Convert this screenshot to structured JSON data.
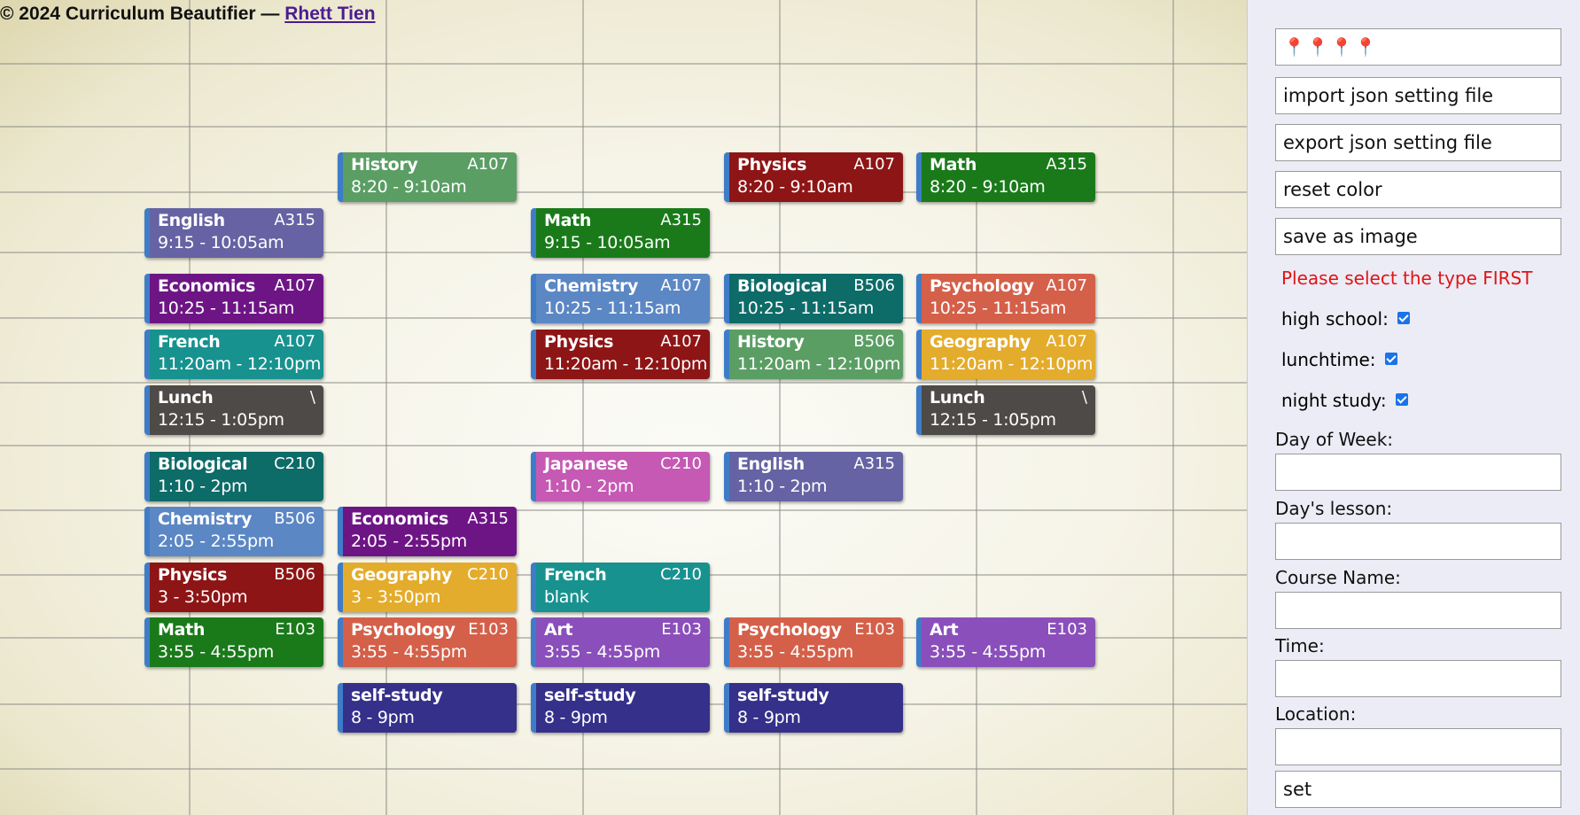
{
  "credit": {
    "prefix": "© 2024 Curriculum Beautifier — ",
    "author": "Rhett Tien"
  },
  "colors": {
    "History": "#5a9e64",
    "Physics": "#8e1515",
    "Math": "#1a7a1a",
    "English": "#6563a3",
    "Economics": "#6e1585",
    "Chemistry": "#5b87c4",
    "Biological": "#0d6b68",
    "Psychology": "#d4604a",
    "French": "#17928f",
    "Geography": "#e4ac2c",
    "Lunch": "#4e4a47",
    "Japanese": "#c559b3",
    "Art": "#8a4fbb",
    "self-study": "#35308a"
  },
  "lessons": [
    {
      "name": "History",
      "room": "A107",
      "time": "8:20 - 9:10am",
      "col": 1,
      "row": 0
    },
    {
      "name": "Physics",
      "room": "A107",
      "time": "8:20 - 9:10am",
      "col": 3,
      "row": 0
    },
    {
      "name": "Math",
      "room": "A315",
      "time": "8:20 - 9:10am",
      "col": 4,
      "row": 0
    },
    {
      "name": "English",
      "room": "A315",
      "time": "9:15 - 10:05am",
      "col": 0,
      "row": 1
    },
    {
      "name": "Math",
      "room": "A315",
      "time": "9:15 - 10:05am",
      "col": 2,
      "row": 1
    },
    {
      "name": "Economics",
      "room": "A107",
      "time": "10:25 - 11:15am",
      "col": 0,
      "row": 2
    },
    {
      "name": "Chemistry",
      "room": "A107",
      "time": "10:25 - 11:15am",
      "col": 2,
      "row": 2
    },
    {
      "name": "Biological",
      "room": "B506",
      "time": "10:25 - 11:15am",
      "col": 3,
      "row": 2
    },
    {
      "name": "Psychology",
      "room": "A107",
      "time": "10:25 - 11:15am",
      "col": 4,
      "row": 2
    },
    {
      "name": "French",
      "room": "A107",
      "time": "11:20am - 12:10pm",
      "col": 0,
      "row": 3
    },
    {
      "name": "Physics",
      "room": "A107",
      "time": "11:20am - 12:10pm",
      "col": 2,
      "row": 3
    },
    {
      "name": "History",
      "room": "B506",
      "time": "11:20am - 12:10pm",
      "col": 3,
      "row": 3
    },
    {
      "name": "Geography",
      "room": "A107",
      "time": "11:20am - 12:10pm",
      "col": 4,
      "row": 3
    },
    {
      "name": "Lunch",
      "room": "\\",
      "time": "12:15 - 1:05pm",
      "col": 0,
      "row": 4
    },
    {
      "name": "Lunch",
      "room": "\\",
      "time": "12:15 - 1:05pm",
      "col": 4,
      "row": 4
    },
    {
      "name": "Biological",
      "room": "C210",
      "time": "1:10 - 2pm",
      "col": 0,
      "row": 5
    },
    {
      "name": "Japanese",
      "room": "C210",
      "time": "1:10 - 2pm",
      "col": 2,
      "row": 5
    },
    {
      "name": "English",
      "room": "A315",
      "time": "1:10 - 2pm",
      "col": 3,
      "row": 5
    },
    {
      "name": "Chemistry",
      "room": "B506",
      "time": "2:05 - 2:55pm",
      "col": 0,
      "row": 6
    },
    {
      "name": "Economics",
      "room": "A315",
      "time": "2:05 - 2:55pm",
      "col": 1,
      "row": 6
    },
    {
      "name": "Physics",
      "room": "B506",
      "time": "3 - 3:50pm",
      "col": 0,
      "row": 7
    },
    {
      "name": "Geography",
      "room": "C210",
      "time": "3 - 3:50pm",
      "col": 1,
      "row": 7
    },
    {
      "name": "French",
      "room": "C210",
      "time": "blank",
      "col": 2,
      "row": 7
    },
    {
      "name": "Math",
      "room": "E103",
      "time": "3:55 - 4:55pm",
      "col": 0,
      "row": 8
    },
    {
      "name": "Psychology",
      "room": "E103",
      "time": "3:55 - 4:55pm",
      "col": 1,
      "row": 8
    },
    {
      "name": "Art",
      "room": "E103",
      "time": "3:55 - 4:55pm",
      "col": 2,
      "row": 8
    },
    {
      "name": "Psychology",
      "room": "E103",
      "time": "3:55 - 4:55pm",
      "col": 3,
      "row": 8
    },
    {
      "name": "Art",
      "room": "E103",
      "time": "3:55 - 4:55pm",
      "col": 4,
      "row": 8
    },
    {
      "name": "self-study",
      "room": "",
      "time": "8 - 9pm",
      "col": 1,
      "row": 9
    },
    {
      "name": "self-study",
      "room": "",
      "time": "8 - 9pm",
      "col": 2,
      "row": 9
    },
    {
      "name": "self-study",
      "room": "",
      "time": "8 - 9pm",
      "col": 3,
      "row": 9
    }
  ],
  "panel": {
    "pins_icon": "pushpin-icon",
    "pin_count": 4,
    "import_label": "import json setting file",
    "export_label": "export json setting file",
    "reset_label": "reset color",
    "save_label": "save as image",
    "warning": "Please select the type FIRST",
    "high_school_label": "high school:",
    "lunchtime_label": "lunchtime:",
    "night_study_label": "night study:",
    "high_school_checked": true,
    "lunchtime_checked": true,
    "night_study_checked": true,
    "day_of_week_label": "Day of Week:",
    "day_lesson_label": "Day's lesson:",
    "course_name_label": "Course Name:",
    "time_label": "Time:",
    "location_label": "Location:",
    "set_label": "set"
  }
}
